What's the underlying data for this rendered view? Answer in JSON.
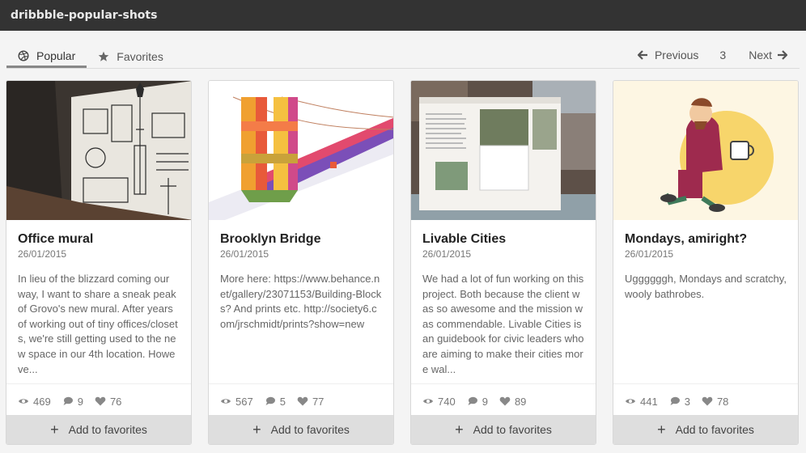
{
  "window": {
    "title": "dribbble-popular-shots"
  },
  "tabs": [
    {
      "label": "Popular",
      "icon": "dribbble-icon",
      "active": true
    },
    {
      "label": "Favorites",
      "icon": "star-icon",
      "active": false
    }
  ],
  "pager": {
    "previous": "Previous",
    "page": "3",
    "next": "Next"
  },
  "cards": [
    {
      "title": "Office mural",
      "date": "26/01/2015",
      "description": "In lieu of the blizzard coming our way, I want to share a sneak peak of Grovo's new mural. After years of working out of tiny offices/closets, we're still getting used to the new space in our 4th location. Howeve...",
      "views": "469",
      "comments": "9",
      "likes": "76",
      "button": "Add to favorites"
    },
    {
      "title": "Brooklyn Bridge",
      "date": "26/01/2015",
      "description": "More here: https://www.behance.net/gallery/23071153/Building-Blocks? And prints etc. http://society6.com/jrschmidt/prints?show=new",
      "views": "567",
      "comments": "5",
      "likes": "77",
      "button": "Add to favorites"
    },
    {
      "title": "Livable Cities",
      "date": "26/01/2015",
      "description": "We had a lot of fun working on this project. Both because the client was so awesome and the mission was commendable. Livable Cities is an guidebook for civic leaders who are aiming to make their cities more wal...",
      "views": "740",
      "comments": "9",
      "likes": "89",
      "button": "Add to favorites"
    },
    {
      "title": "Mondays, amiright?",
      "date": "26/01/2015",
      "description": "Uggggggh, Mondays and scratchy, wooly bathrobes.",
      "views": "441",
      "comments": "3",
      "likes": "78",
      "button": "Add to favorites"
    }
  ]
}
